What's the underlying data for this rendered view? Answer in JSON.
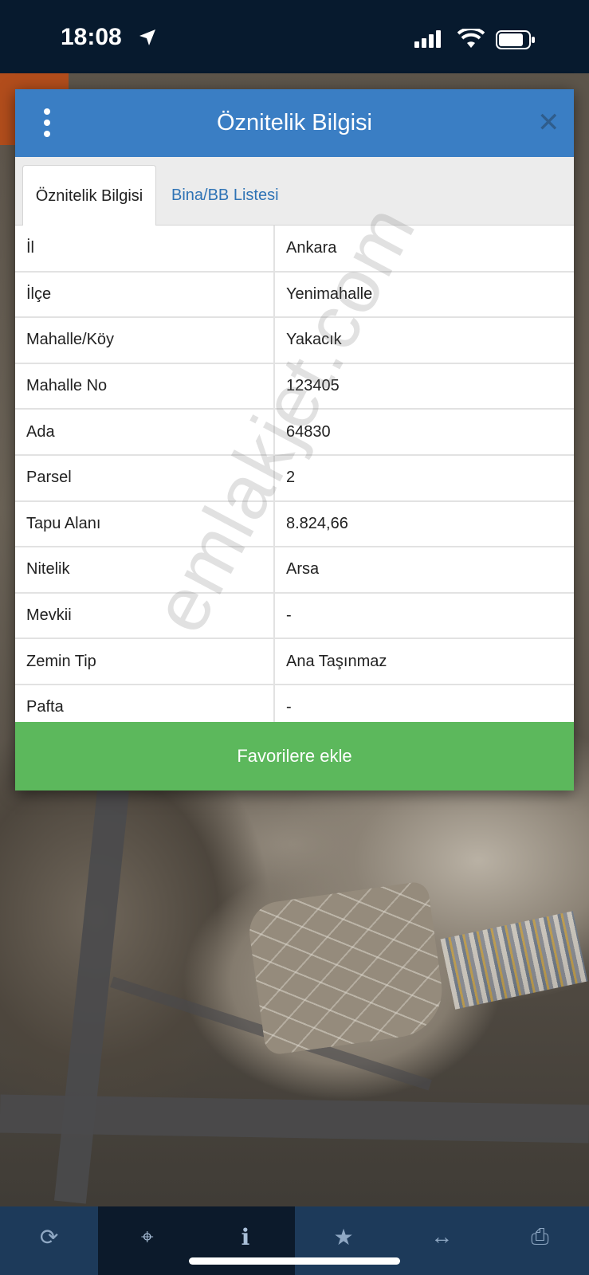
{
  "status_bar": {
    "time": "18:08",
    "location_icon": "location-arrow-icon",
    "signal_icon": "cellular-signal-icon",
    "wifi_icon": "wifi-icon",
    "battery_icon": "battery-icon"
  },
  "modal": {
    "title": "Öznitelik Bilgisi",
    "menu_icon": "vertical-dots-icon",
    "close_icon": "close-icon",
    "tabs": [
      {
        "label": "Öznitelik Bilgisi",
        "active": true
      },
      {
        "label": "Bina/BB Listesi",
        "active": false
      }
    ],
    "rows": [
      {
        "key": "İl",
        "value": "Ankara"
      },
      {
        "key": "İlçe",
        "value": "Yenimahalle"
      },
      {
        "key": "Mahalle/Köy",
        "value": "Yakacık"
      },
      {
        "key": "Mahalle No",
        "value": "123405"
      },
      {
        "key": "Ada",
        "value": "64830"
      },
      {
        "key": "Parsel",
        "value": "2"
      },
      {
        "key": "Tapu Alanı",
        "value": "8.824,66"
      },
      {
        "key": "Nitelik",
        "value": "Arsa"
      },
      {
        "key": "Mevkii",
        "value": "-"
      },
      {
        "key": "Zemin Tip",
        "value": "Ana Taşınmaz"
      },
      {
        "key": "Pafta",
        "value": "-"
      }
    ],
    "favorite_button": "Favorilere ekle"
  },
  "watermark": "emlakjet.com",
  "toolbar": {
    "items": [
      {
        "icon": "refresh-icon",
        "glyph": "⟳"
      },
      {
        "icon": "locate-crosshair-icon",
        "glyph": "⌖"
      },
      {
        "icon": "info-icon",
        "glyph": "i"
      },
      {
        "icon": "star-icon",
        "glyph": "★"
      },
      {
        "icon": "measure-arrows-icon",
        "glyph": "↔"
      },
      {
        "icon": "print-icon",
        "glyph": "⎙"
      }
    ],
    "active_range": [
      1,
      2
    ]
  },
  "colors": {
    "header_blue": "#3a7ec4",
    "tab_link": "#2f73b5",
    "favorite_green": "#5cb85c",
    "toolbar_bg": "#1d3a5a"
  }
}
